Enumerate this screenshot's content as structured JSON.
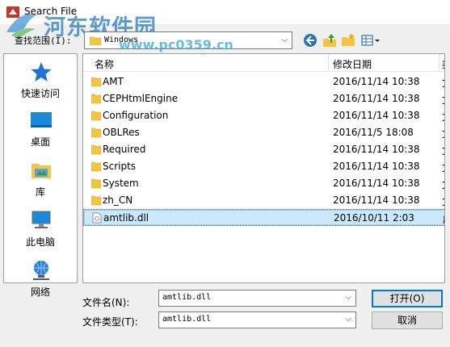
{
  "window": {
    "title": "Search File",
    "watermark": "河东软件园",
    "watermark_url": "www.pc0359.cn"
  },
  "lookin": {
    "label": "查找范围(I):",
    "value": "Windows"
  },
  "places": [
    {
      "label": "快速访问",
      "icon": "star-icon"
    },
    {
      "label": "桌面",
      "icon": "desktop-icon"
    },
    {
      "label": "库",
      "icon": "library-icon"
    },
    {
      "label": "此电脑",
      "icon": "computer-icon"
    },
    {
      "label": "网络",
      "icon": "network-icon"
    }
  ],
  "columns": {
    "name": "名称",
    "date": "修改日期",
    "type": "类"
  },
  "files": [
    {
      "name": "AMT",
      "date": "2016/11/14 10:38",
      "type": "文",
      "kind": "folder"
    },
    {
      "name": "CEPHtmlEngine",
      "date": "2016/11/14 10:38",
      "type": "文",
      "kind": "folder"
    },
    {
      "name": "Configuration",
      "date": "2016/11/14 10:38",
      "type": "文",
      "kind": "folder"
    },
    {
      "name": "OBLRes",
      "date": "2016/11/5 18:08",
      "type": "文",
      "kind": "folder"
    },
    {
      "name": "Required",
      "date": "2016/11/14 10:38",
      "type": "文",
      "kind": "folder"
    },
    {
      "name": "Scripts",
      "date": "2016/11/14 10:38",
      "type": "文",
      "kind": "folder"
    },
    {
      "name": "System",
      "date": "2016/11/14 10:38",
      "type": "文",
      "kind": "folder"
    },
    {
      "name": "zh_CN",
      "date": "2016/11/14 10:38",
      "type": "文",
      "kind": "folder"
    },
    {
      "name": "amtlib.dll",
      "date": "2016/10/11 2:03",
      "type": "应",
      "kind": "file",
      "selected": true
    }
  ],
  "filename": {
    "label": "文件名(N):",
    "value": "amtlib.dll"
  },
  "filetype": {
    "label": "文件类型(T):",
    "value": "amtlib.dll"
  },
  "buttons": {
    "open": "打开(O)",
    "cancel": "取消"
  },
  "colors": {
    "folder": "#f5c542",
    "selection": "#cce8ff",
    "accent": "#0078d7"
  }
}
